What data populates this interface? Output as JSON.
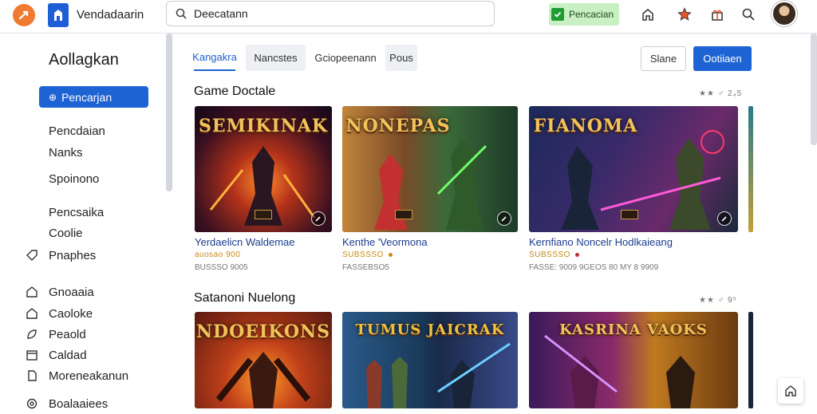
{
  "header": {
    "site_name": "Vendadaarin",
    "search_value": "Deecatann",
    "promo_label": "Pencacian"
  },
  "sidebar": {
    "title": "Aollagkan",
    "primary_item": "Pencarjan",
    "group1": [
      "Pencdaian",
      "Nanks",
      "Spoinono"
    ],
    "group2": [
      "Pencsaika",
      "Coolie",
      "Pnaphes"
    ],
    "group3": [
      "Gnoaaia",
      "Caoloke",
      "Peaold",
      "Caldad",
      "Moreneakanun",
      "Boalaaiees"
    ]
  },
  "main": {
    "tabs": [
      "Kangakra",
      "Nancstes",
      "Gciopeenann",
      "Pous"
    ],
    "secondary_button": "Slane",
    "primary_button": "Ootiiaen",
    "sections": [
      {
        "title": "Game Doctale",
        "rating": "★★ ♂ 2₄5",
        "cards": [
          {
            "art_title": "SEMIKINAK",
            "name": "Yerdaelicn Waldemae",
            "meta": "auosao 900",
            "sub": "BUSSSO 9005"
          },
          {
            "art_title": "NONEPAS",
            "name": "Kenthe 'Veormona",
            "meta": "SUBSSSO",
            "sub": "FASSEBSO5"
          },
          {
            "art_title": "FIANOMA",
            "name": "Kernfiano Noncelr Hodlkaieang",
            "meta": "SUBSSSO",
            "sub": "FASSE: 9009 9GEOS 80 MY 8 9909"
          }
        ]
      },
      {
        "title": "Satanoni Nuelong",
        "rating": "★★ ♂ 9⁵",
        "cards": [
          {
            "art_title": "NDOEIKONS"
          },
          {
            "art_title": "TUMUS JAICRAK"
          },
          {
            "art_title": "KASRINA VAOKS"
          }
        ]
      }
    ]
  },
  "colors": {
    "accent": "#1e63d3",
    "promo_bg": "#c9f0c4",
    "logo_orange": "#f07a30"
  }
}
